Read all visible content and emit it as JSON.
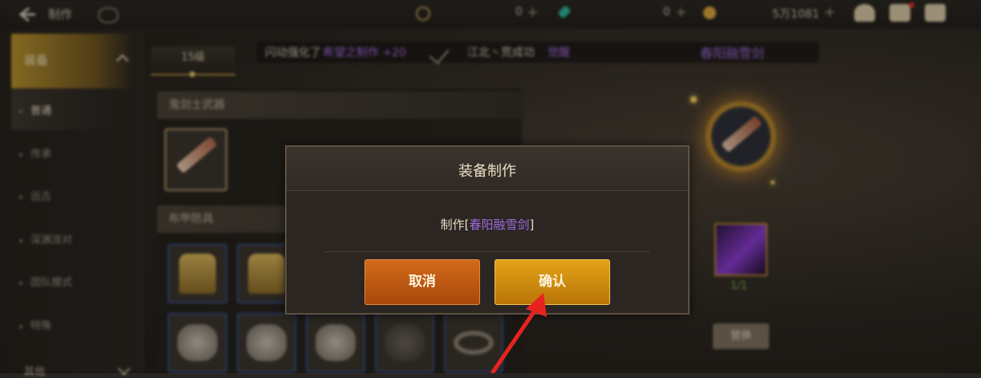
{
  "topbar": {
    "title": "制作",
    "resources": [
      {
        "icon": "moon-coin-icon",
        "value": "0"
      },
      {
        "icon": "gem-icon",
        "value": "0"
      },
      {
        "icon": "gold-icon",
        "value": "5万1081"
      }
    ]
  },
  "sidebar": {
    "category": "装备",
    "items": [
      {
        "label": "普通"
      },
      {
        "label": "传承"
      },
      {
        "label": "远古"
      },
      {
        "label": "深渊派对"
      },
      {
        "label": "团队模式"
      },
      {
        "label": "特殊"
      }
    ],
    "bottom_category": "其他"
  },
  "level_tab": "15级",
  "ticker": {
    "part1": "闪动强化了",
    "part2": "希望之制作 +20",
    "part3": "江北丶荒成功",
    "part4": "觉醒"
  },
  "sections": [
    {
      "label": "鬼剑士武器"
    },
    {
      "label": "布甲防具"
    }
  ],
  "preview": {
    "item_name": "春阳融雪剑",
    "material_count": "1/1",
    "replace_label": "替换"
  },
  "modal": {
    "title": "装备制作",
    "message_prefix": "制作[",
    "message_item": "春阳融雪剑",
    "message_suffix": "]",
    "cancel_label": "取消",
    "confirm_label": "确认"
  },
  "colors": {
    "accent_gold": "#e3a318",
    "cancel_orange": "#d26a1a",
    "epic_purple": "#9c6ee0",
    "arrow_red": "#e8231f"
  }
}
